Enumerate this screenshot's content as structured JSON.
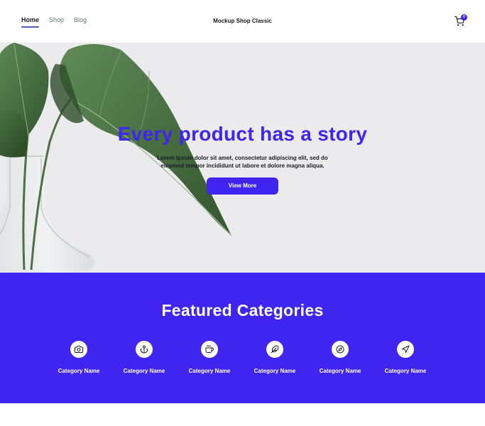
{
  "header": {
    "nav": [
      {
        "label": "Home",
        "active": true
      },
      {
        "label": "Shop",
        "active": false
      },
      {
        "label": "Blog",
        "active": false
      }
    ],
    "brand": "Mockup Shop Classic",
    "cart": {
      "icon": "cart-icon",
      "badge": "0"
    }
  },
  "hero": {
    "title": "Every product has a story",
    "subtitle": "Lorem ipsum dolor sit amet, consectetur adipiscing elit, sed do eiusmod tempor incididunt ut labore et dolore magna aliqua.",
    "button_label": "View More",
    "image": "plant-leaves-in-glass-vase"
  },
  "categories": {
    "title": "Featured Categories",
    "items": [
      {
        "label": "Category Name",
        "icon": "camera-icon"
      },
      {
        "label": "Category Name",
        "icon": "anchor-icon"
      },
      {
        "label": "Category Name",
        "icon": "coffee-icon"
      },
      {
        "label": "Category Name",
        "icon": "feather-icon"
      },
      {
        "label": "Category Name",
        "icon": "compass-icon"
      },
      {
        "label": "Category Name",
        "icon": "send-icon"
      }
    ]
  },
  "colors": {
    "accent": "#4024f0",
    "hero_bg": "#ebebee",
    "text": "#1c1c28"
  }
}
